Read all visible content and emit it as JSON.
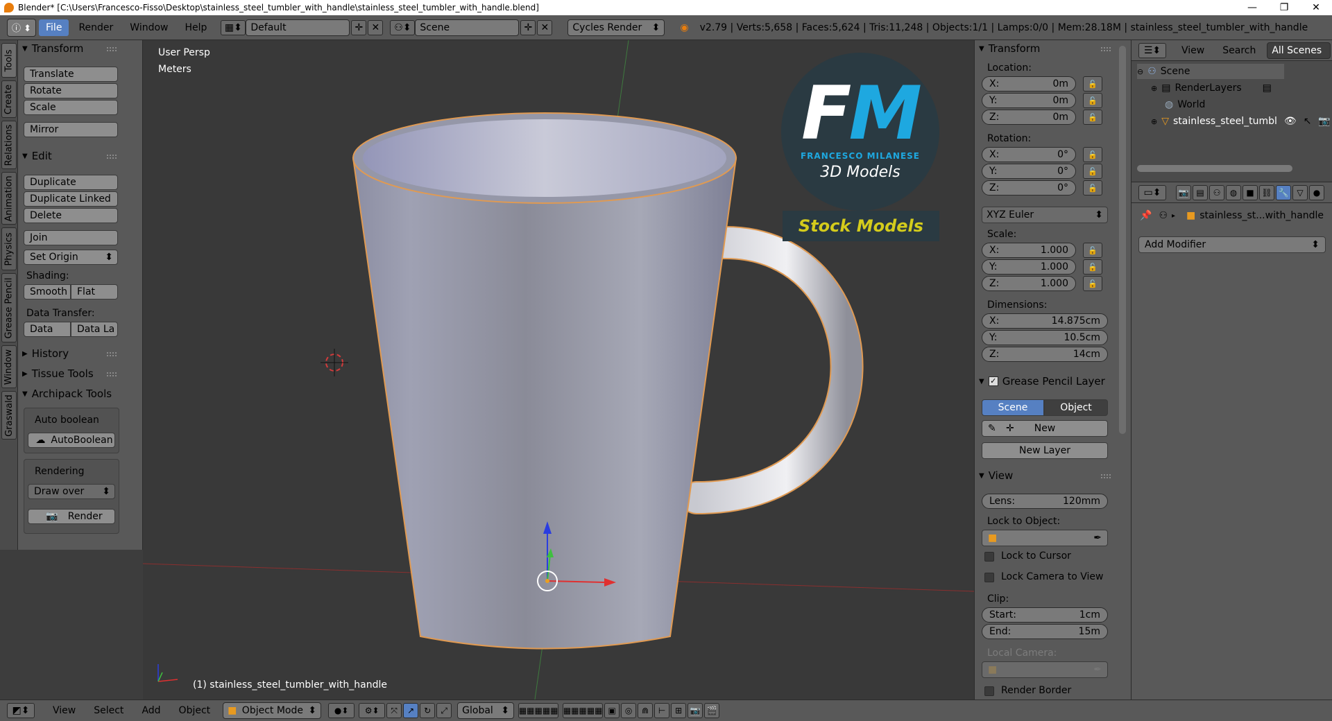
{
  "window": {
    "title": "Blender* [C:\\Users\\Francesco-Fisso\\Desktop\\stainless_steel_tumbler_with_handle\\stainless_steel_tumbler_with_handle.blend]",
    "minimize": "—",
    "maximize": "❐",
    "close": "✕"
  },
  "info_header": {
    "menu": [
      "File",
      "Render",
      "Window",
      "Help"
    ],
    "layout": "Default",
    "scene": "Scene",
    "engine": "Cycles Render",
    "stats": "v2.79 | Verts:5,658 | Faces:5,624 | Tris:11,248 | Objects:1/1 | Lamps:0/0 | Mem:28.18M | stainless_steel_tumbler_with_handle"
  },
  "tabs": [
    "Tools",
    "Create",
    "Relations",
    "Animation",
    "Physics",
    "Grease Pencil",
    "Window",
    "Graswald"
  ],
  "toolshelf": {
    "transform_title": "Transform",
    "translate": "Translate",
    "rotate": "Rotate",
    "scale": "Scale",
    "mirror": "Mirror",
    "edit_title": "Edit",
    "duplicate": "Duplicate",
    "duplicate_linked": "Duplicate Linked",
    "delete": "Delete",
    "join": "Join",
    "set_origin": "Set Origin",
    "shading_label": "Shading:",
    "smooth": "Smooth",
    "flat": "Flat",
    "data_transfer_label": "Data Transfer:",
    "data": "Data",
    "data_la": "Data La",
    "history_title": "History",
    "tissue_title": "Tissue Tools",
    "archipack_title": "Archipack Tools",
    "auto_boolean_label": "Auto boolean",
    "autoboolean_btn": "AutoBoolean",
    "rendering_label": "Rendering",
    "draw_over": "Draw over",
    "render_btn": "Render"
  },
  "viewport": {
    "view_name": "User Persp",
    "units": "Meters",
    "object_label": "(1) stainless_steel_tumbler_with_handle",
    "logo_letters": "FM",
    "logo_name": "FRANCESCO MILANESE",
    "logo_sub": "3D Models",
    "banner": "Stock Models"
  },
  "npanel": {
    "transform_title": "Transform",
    "location_label": "Location:",
    "loc": [
      {
        "axis": "X:",
        "value": "0m"
      },
      {
        "axis": "Y:",
        "value": "0m"
      },
      {
        "axis": "Z:",
        "value": "0m"
      }
    ],
    "rotation_label": "Rotation:",
    "rot": [
      {
        "axis": "X:",
        "value": "0°"
      },
      {
        "axis": "Y:",
        "value": "0°"
      },
      {
        "axis": "Z:",
        "value": "0°"
      }
    ],
    "rotation_mode": "XYZ Euler",
    "scale_label": "Scale:",
    "scl": [
      {
        "axis": "X:",
        "value": "1.000"
      },
      {
        "axis": "Y:",
        "value": "1.000"
      },
      {
        "axis": "Z:",
        "value": "1.000"
      }
    ],
    "dimensions_label": "Dimensions:",
    "dim": [
      {
        "axis": "X:",
        "value": "14.875cm"
      },
      {
        "axis": "Y:",
        "value": "10.5cm"
      },
      {
        "axis": "Z:",
        "value": "14cm"
      }
    ],
    "gp_title": "Grease Pencil Layer",
    "gp_scene": "Scene",
    "gp_object": "Object",
    "gp_new": "New",
    "gp_new_layer": "New Layer",
    "view_title": "View",
    "lens_label": "Lens:",
    "lens_value": "120mm",
    "lock_to_object_label": "Lock to Object:",
    "lock_to_cursor": "Lock to Cursor",
    "lock_camera": "Lock Camera to View",
    "clip_label": "Clip:",
    "clip_start_label": "Start:",
    "clip_start": "1cm",
    "clip_end_label": "End:",
    "clip_end": "15m",
    "local_camera_label": "Local Camera:",
    "render_border": "Render Border"
  },
  "outliner": {
    "view": "View",
    "search": "Search",
    "all_scenes": "All Scenes",
    "items": [
      "Scene",
      "RenderLayers",
      "World",
      "stainless_steel_tumbl"
    ]
  },
  "properties": {
    "object_name": "stainless_st...with_handle",
    "add_modifier": "Add Modifier"
  },
  "bottom": {
    "view": "View",
    "select": "Select",
    "add": "Add",
    "object": "Object",
    "mode": "Object Mode",
    "orientation": "Global"
  }
}
